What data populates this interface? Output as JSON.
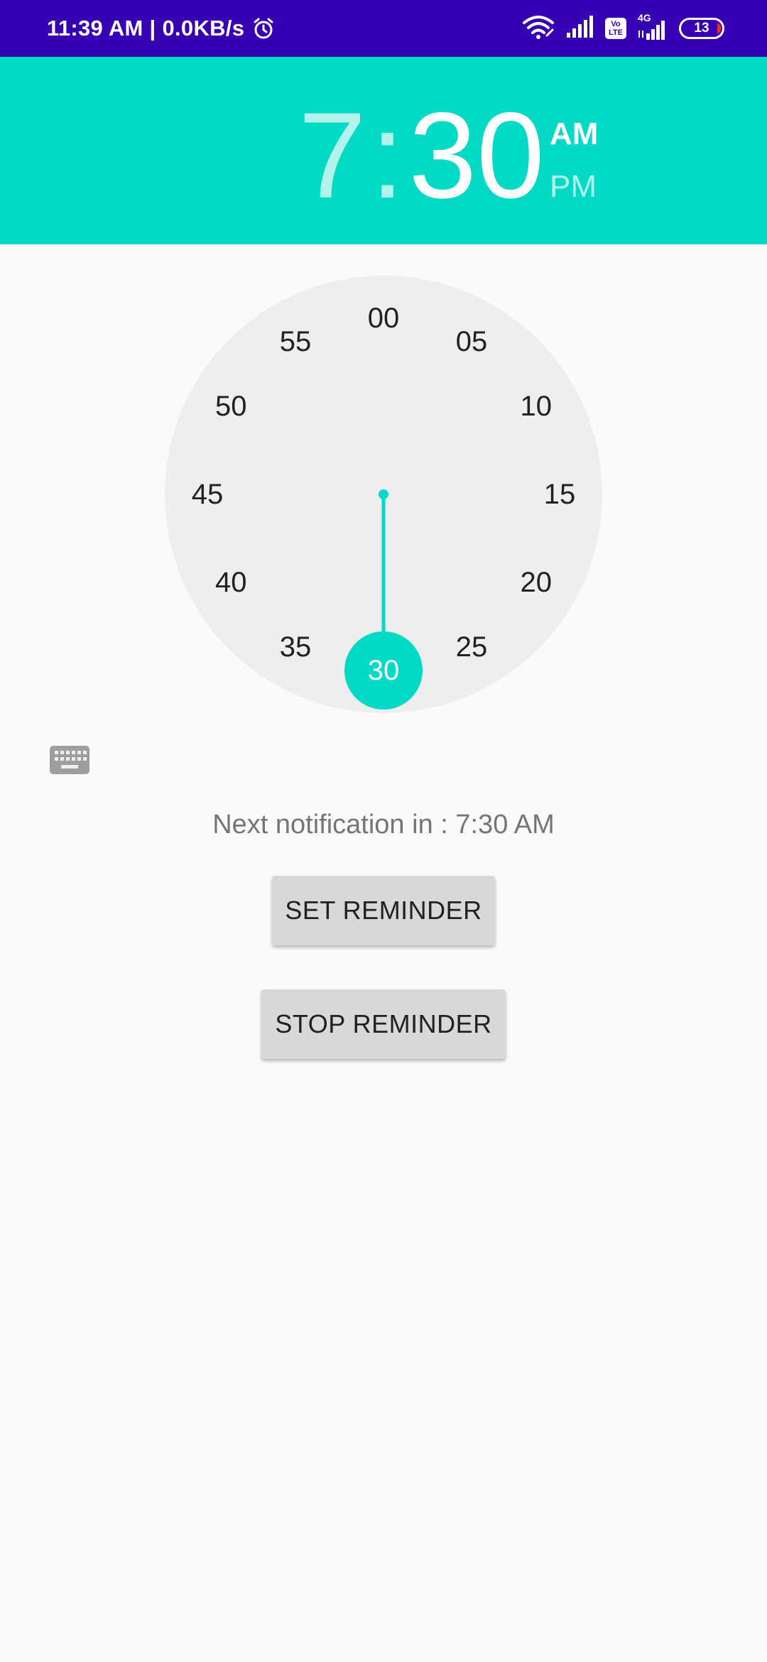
{
  "status_bar": {
    "time_speed": "11:39 AM | 0.0KB/s",
    "volte": "Vo LTE",
    "network": "4G",
    "battery": "13",
    "icons": [
      "alarm-icon",
      "wifi-icon",
      "signal-icon",
      "volte-icon",
      "signal-4g-icon",
      "battery-icon"
    ]
  },
  "time_header": {
    "hour": "7",
    "separator": ":",
    "minute": "30",
    "am_label": "AM",
    "pm_label": "PM",
    "selected_period": "AM"
  },
  "clock": {
    "mode": "minutes",
    "ticks": [
      "00",
      "05",
      "10",
      "15",
      "20",
      "25",
      "30",
      "35",
      "40",
      "45",
      "50",
      "55"
    ],
    "selected": "30"
  },
  "notification": {
    "text": "Next notification in : 7:30 AM"
  },
  "buttons": {
    "set_label": "SET REMINDER",
    "stop_label": "STOP REMINDER"
  },
  "colors": {
    "status_bar": "#3700b3",
    "accent": "#03dac5",
    "dial": "#eeeeee",
    "button": "#d7d8d7"
  }
}
